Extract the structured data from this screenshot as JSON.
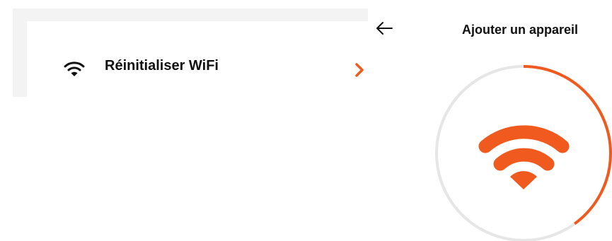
{
  "settings_row": {
    "icon": "wifi-icon",
    "label": "Réinitialiser WiFi",
    "chevron": "chevron-right-icon"
  },
  "add_device_screen": {
    "back_icon": "arrow-left-icon",
    "title": "Ajouter un appareil",
    "center_icon": "wifi-icon",
    "progress_fraction": 0.4
  },
  "colors": {
    "accent": "#F15A1E",
    "track": "#E6E6E6",
    "panel_bg": "#F3F3F4",
    "text": "#111111"
  }
}
